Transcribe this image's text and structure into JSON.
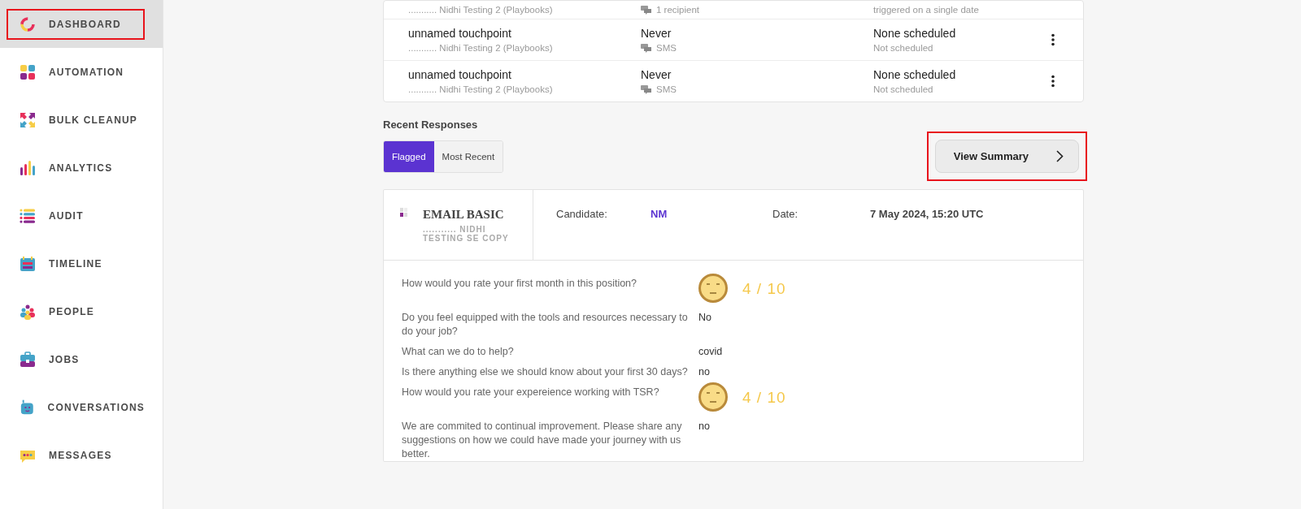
{
  "sidebar": {
    "items": [
      {
        "label": "DASHBOARD",
        "selected": true,
        "highlighted": true
      },
      {
        "label": "AUTOMATION",
        "selected": false,
        "highlighted": false
      },
      {
        "label": "BULK CLEANUP",
        "selected": false,
        "highlighted": false
      },
      {
        "label": "ANALYTICS",
        "selected": false,
        "highlighted": false
      },
      {
        "label": "AUDIT",
        "selected": false,
        "highlighted": false
      },
      {
        "label": "TIMELINE",
        "selected": false,
        "highlighted": false
      },
      {
        "label": "PEOPLE",
        "selected": false,
        "highlighted": false
      },
      {
        "label": "JOBS",
        "selected": false,
        "highlighted": false
      },
      {
        "label": "CONVERSATIONS",
        "selected": false,
        "highlighted": false
      },
      {
        "label": "MESSAGES",
        "selected": false,
        "highlighted": false
      }
    ]
  },
  "touchpoints": [
    {
      "kind": "partial",
      "subtitle": "........... Nidhi Testing 2 (Playbooks)",
      "channel": "1 recipient",
      "schedule_note": "triggered on a single date"
    },
    {
      "kind": "full",
      "title": "unnamed touchpoint",
      "subtitle": "........... Nidhi Testing 2 (Playbooks)",
      "last_sent": "Never",
      "channel": "SMS",
      "schedule": "None scheduled",
      "schedule_note": "Not scheduled"
    },
    {
      "kind": "full",
      "title": "unnamed touchpoint",
      "subtitle": "........... Nidhi Testing 2 (Playbooks)",
      "last_sent": "Never",
      "channel": "SMS",
      "schedule": "None scheduled",
      "schedule_note": "Not scheduled"
    }
  ],
  "recent_responses": {
    "title": "Recent Responses",
    "tabs": [
      {
        "label": "Flagged",
        "selected": true
      },
      {
        "label": "Most Recent",
        "selected": false
      }
    ],
    "summary_button": {
      "label": "View Summary",
      "highlighted": true
    },
    "response": {
      "survey": "EMAIL BASIC",
      "source": "........... NIDHI TESTING SE COPY",
      "candidate_label": "Candidate:",
      "candidate": "NM",
      "date_label": "Date:",
      "date": "7 May 2024, 15:20 UTC",
      "answers": [
        {
          "kind": "rating",
          "question": "How would you rate your first month in this position?",
          "answer": "4 / 10"
        },
        {
          "kind": "text",
          "question": "Do you feel equipped with the tools and resources necessary to do your job?",
          "answer": "No"
        },
        {
          "kind": "text",
          "question": "What can we do to help?",
          "answer": "covid"
        },
        {
          "kind": "text",
          "question": "Is there anything else we should know about your first 30 days?",
          "answer": "no"
        },
        {
          "kind": "rating",
          "question": "How would you rate your expereience working with TSR?",
          "answer": "4 / 10"
        },
        {
          "kind": "text",
          "question": "We are commited to continual improvement. Please share any suggestions on how we could have made your journey with us better.",
          "answer": "no"
        }
      ]
    }
  }
}
